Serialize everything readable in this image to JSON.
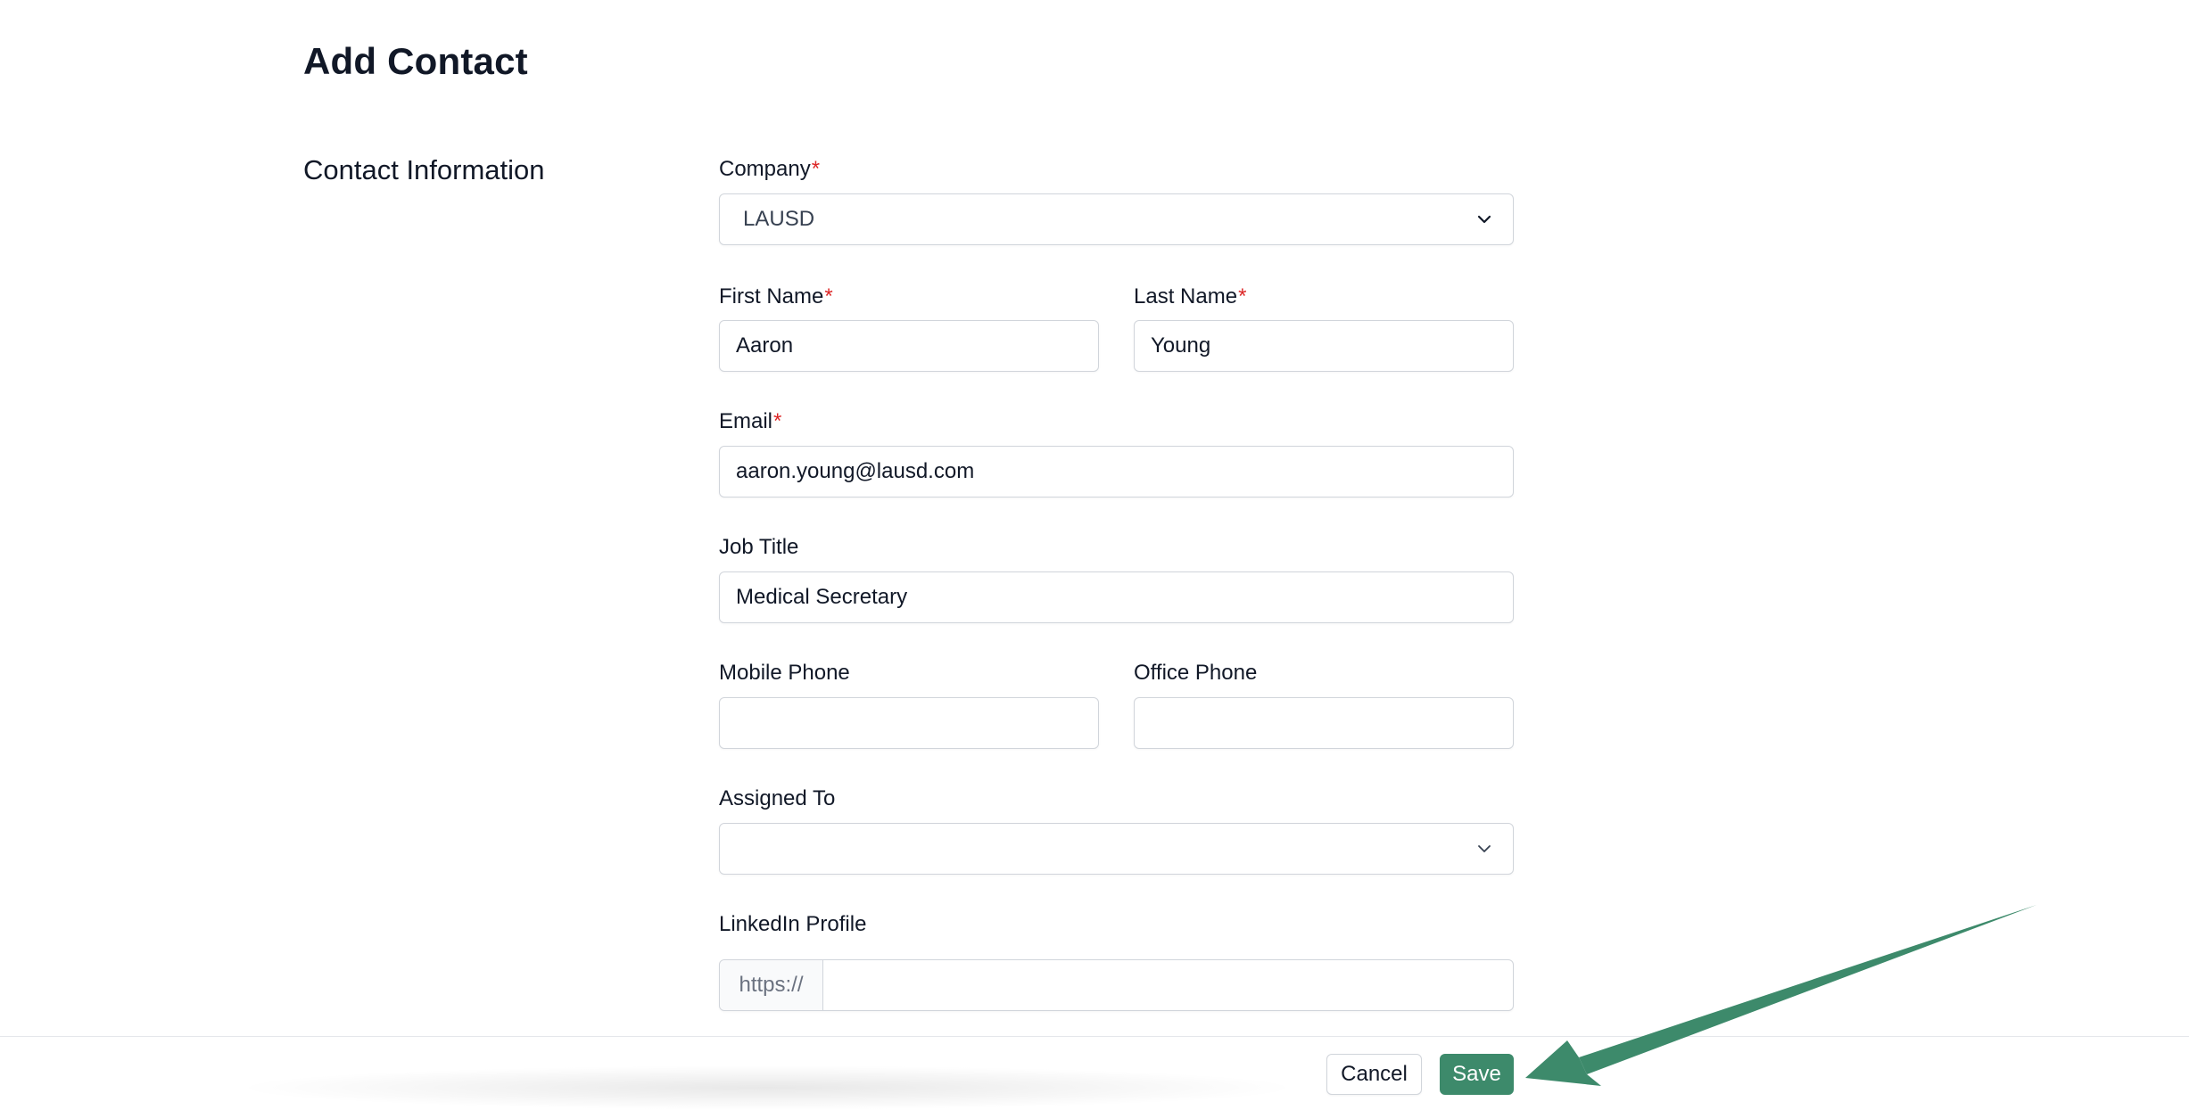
{
  "page": {
    "title": "Add Contact",
    "section_title": "Contact Information"
  },
  "form": {
    "required_marker": "*",
    "company": {
      "label": "Company",
      "value": "LAUSD",
      "icon": "chevron-down-icon"
    },
    "first_name": {
      "label": "First Name",
      "value": "Aaron"
    },
    "last_name": {
      "label": "Last Name",
      "value": "Young"
    },
    "email": {
      "label": "Email",
      "value": "aaron.young@lausd.com"
    },
    "job_title": {
      "label": "Job Title",
      "value": "Medical Secretary"
    },
    "mobile_phone": {
      "label": "Mobile Phone",
      "value": ""
    },
    "office_phone": {
      "label": "Office Phone",
      "value": ""
    },
    "assigned_to": {
      "label": "Assigned To",
      "value": "",
      "icon": "chevron-down-icon"
    },
    "linkedin": {
      "label": "LinkedIn Profile",
      "prefix": "https://",
      "value": ""
    }
  },
  "footer": {
    "cancel_label": "Cancel",
    "save_label": "Save"
  },
  "annotation": {
    "icon": "arrow-icon",
    "color": "#3d8a6b",
    "points_to": "save-button"
  },
  "colors": {
    "primary": "#3d8a6b",
    "required": "#dc2626",
    "border": "#d1d5db"
  }
}
